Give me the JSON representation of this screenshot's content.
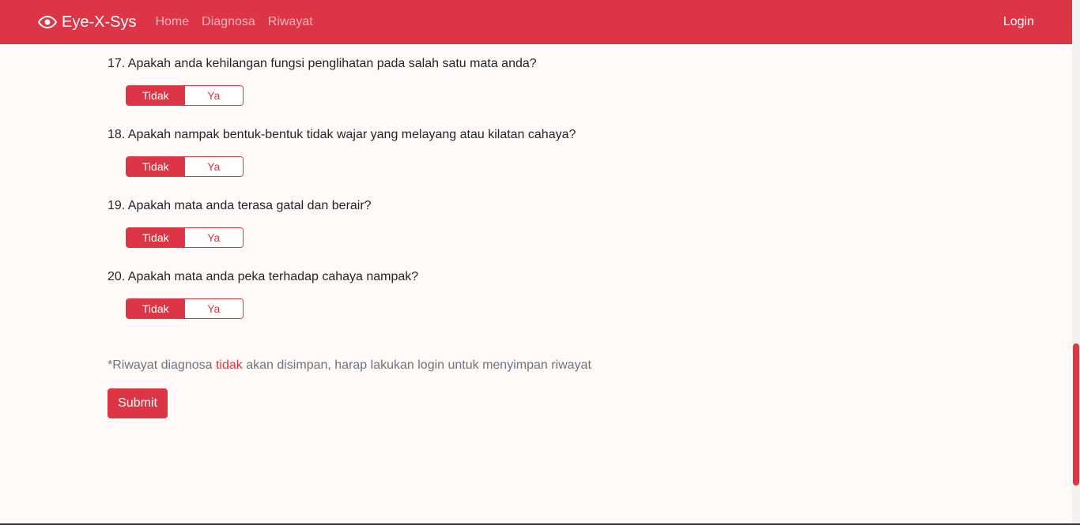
{
  "navbar": {
    "brand": "Eye-X-Sys",
    "links": [
      "Home",
      "Diagnosa",
      "Riwayat"
    ],
    "login": "Login"
  },
  "questions": [
    {
      "text": "17. Apakah anda kehilangan fungsi penglihatan pada salah satu mata anda?",
      "no": "Tidak",
      "yes": "Ya",
      "selected": "Tidak"
    },
    {
      "text": "18. Apakah nampak bentuk-bentuk tidak wajar yang melayang atau kilatan cahaya?",
      "no": "Tidak",
      "yes": "Ya",
      "selected": "Tidak"
    },
    {
      "text": "19. Apakah mata anda terasa gatal dan berair?",
      "no": "Tidak",
      "yes": "Ya",
      "selected": "Tidak"
    },
    {
      "text": "20. Apakah mata anda peka terhadap cahaya nampak?",
      "no": "Tidak",
      "yes": "Ya",
      "selected": "Tidak"
    }
  ],
  "note": {
    "before": "*Riwayat diagnosa ",
    "highlight": "tidak",
    "after": " akan disimpan, harap lakukan login untuk menyimpan riwayat"
  },
  "submit_label": "Submit",
  "colors": {
    "accent": "#dc3545",
    "background": "#fff9f8"
  }
}
